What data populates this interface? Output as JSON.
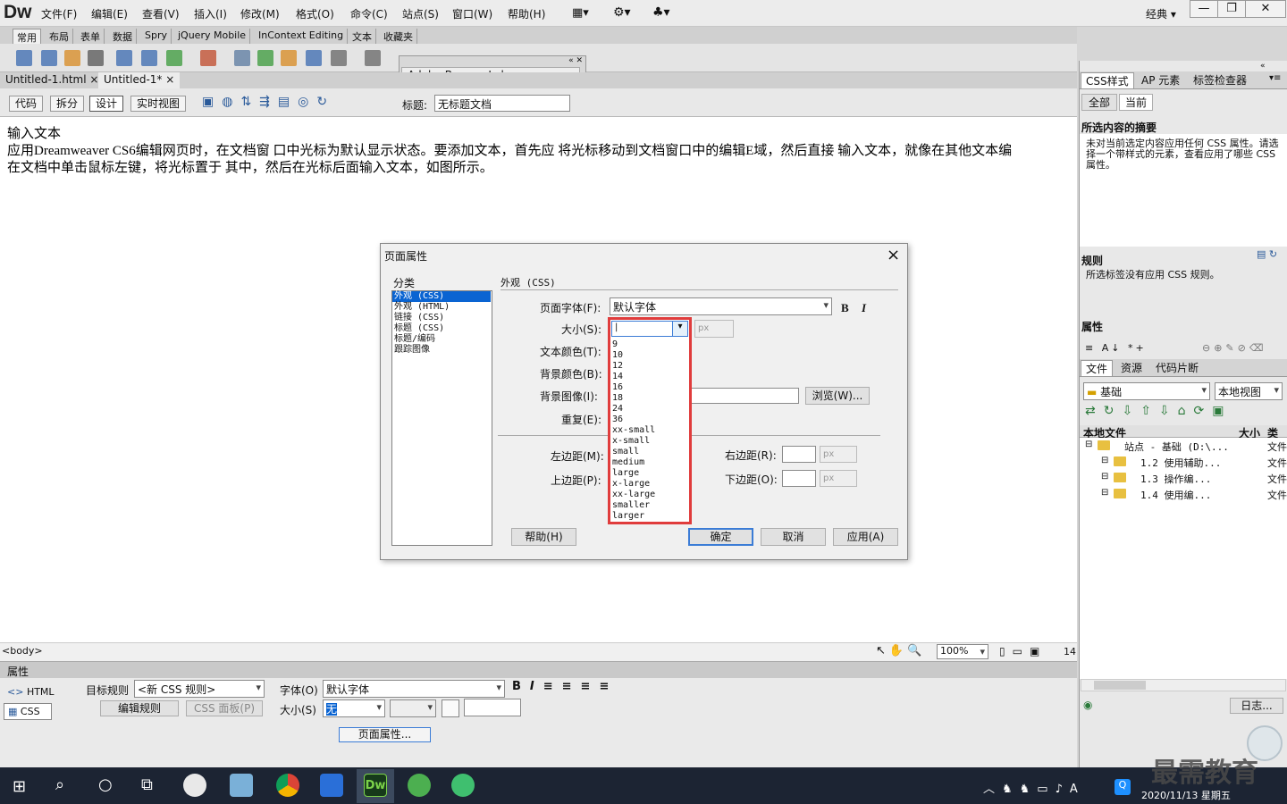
{
  "menubar": {
    "logo": "Dw",
    "items": [
      "文件(F)",
      "编辑(E)",
      "查看(V)",
      "插入(I)",
      "修改(M)",
      "格式(O)",
      "命令(C)",
      "站点(S)",
      "窗口(W)",
      "帮助(H)"
    ],
    "workspace": "经典"
  },
  "insert_tabs": [
    "常用",
    "布局",
    "表单",
    "数据",
    "Spry",
    "jQuery Mobile",
    "InContext Editing",
    "文本",
    "收藏夹"
  ],
  "browserlab": "Adobe BrowserLab",
  "doc_tabs": [
    {
      "label": "Untitled-1.html",
      "close": "×"
    },
    {
      "label": "Untitled-1*",
      "close": "×"
    }
  ],
  "view_buttons": [
    "代码",
    "拆分",
    "设计",
    "实时视图"
  ],
  "title_label": "标题:",
  "title_value": "无标题文档",
  "doc_text": [
    "输入文本",
    "应用Dreamweaver CS6编辑网页时，在文档窗 口中光标为默认显示状态。要添加文本，首先应 将光标移动到文档窗口中的编辑E域，然后直接 输入文本，就像在其他文本编",
    "在文档中单击鼠标左键，将光标置于 其中，然后在光标后面输入文本，如图所示。"
  ],
  "status": {
    "tag": "<body>",
    "zoom": "100%",
    "extra": "14"
  },
  "properties": {
    "header": "属性",
    "html_btn": "HTML",
    "css_btn": "CSS",
    "target_rule_label": "目标规则",
    "target_rule_value": "<新 CSS 规则>",
    "edit_rule": "编辑规则",
    "css_panel": "CSS 面板(P)",
    "font_label": "字体(O)",
    "font_value": "默认字体",
    "size_label": "大小(S)",
    "size_value": "无",
    "page_props": "页面属性..."
  },
  "right_panel": {
    "tabs1": [
      "CSS样式",
      "AP 元素",
      "标签检查器"
    ],
    "subtabs": [
      "全部",
      "当前"
    ],
    "summary_head": "所选内容的摘要",
    "summary_text": "未对当前选定内容应用任何 CSS 属性。请选择一个带样式的元素，查看应用了哪些 CSS 属性。",
    "rules_head": "规则",
    "rules_text": "所选标签没有应用 CSS 规则。",
    "attrs_head": "属性",
    "tabs2": [
      "文件",
      "资源",
      "代码片断"
    ],
    "site": "基础",
    "view": "本地视图",
    "cols": [
      "本地文件",
      "大小",
      "类型"
    ],
    "tree": [
      {
        "label": "站点 - 基础 (D:\\...",
        "type": "文件"
      },
      {
        "label": "1.2 使用辅助...",
        "type": "文件"
      },
      {
        "label": "1.3 操作编...",
        "type": "文件"
      },
      {
        "label": "1.4 使用编...",
        "type": "文件"
      }
    ],
    "log": "日志..."
  },
  "dialog": {
    "title": "页面属性",
    "close": "×",
    "category_label": "分类",
    "categories": [
      "外观 (CSS)",
      "外观 (HTML)",
      "链接 (CSS)",
      "标题 (CSS)",
      "标题/编码",
      "跟踪图像"
    ],
    "section": "外观 (CSS)",
    "page_font_label": "页面字体(F):",
    "page_font_value": "默认字体",
    "bold": "B",
    "italic": "I",
    "size_label": "大小(S):",
    "size_unit": "px",
    "size_current": "|",
    "text_color_label": "文本颜色(T):",
    "bg_color_label": "背景颜色(B):",
    "bg_image_label": "背景图像(I):",
    "browse": "浏览(W)...",
    "repeat_label": "重复(E):",
    "left_margin": "左边距(M):",
    "right_margin": "右边距(R):",
    "top_margin": "上边距(P):",
    "bottom_margin": "下边距(O):",
    "unit": "px",
    "size_options": [
      "9",
      "10",
      "12",
      "14",
      "16",
      "18",
      "24",
      "36",
      "xx-small",
      "x-small",
      "small",
      "medium",
      "large",
      "x-large",
      "xx-large",
      "smaller",
      "larger"
    ],
    "help": "帮助(H)",
    "ok": "确定",
    "cancel": "取消",
    "apply": "应用(A)"
  },
  "taskbar": {
    "clock": "2020/11/13 星期五",
    "ime": "A",
    "watermark": "最需教育"
  },
  "colors": {
    "accent": "#3b7cd6",
    "highlight": "#e03c3c",
    "selection": "#0a64d2"
  }
}
